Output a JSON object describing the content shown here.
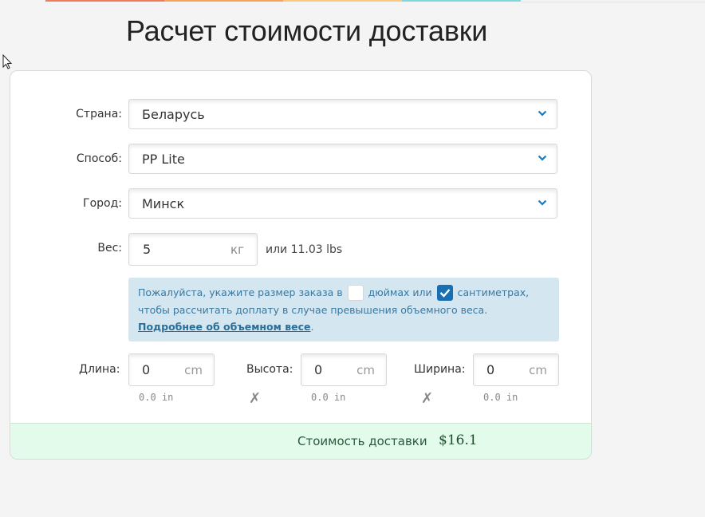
{
  "colors": {
    "top_segments": [
      "#f07a5a",
      "#f7a35c",
      "#fbc880",
      "#7dd8e0"
    ],
    "accent": "#1a6fb3",
    "chevron": "#1a7ac0"
  },
  "page": {
    "title": "Расчет стоимости доставки"
  },
  "form": {
    "country": {
      "label": "Страна:",
      "value": "Беларусь",
      "icon": "chevron-down-icon"
    },
    "method": {
      "label": "Способ:",
      "value": "PP Lite",
      "icon": "chevron-down-icon"
    },
    "city": {
      "label": "Город:",
      "value": "Минск",
      "icon": "chevron-down-icon"
    },
    "weight": {
      "label": "Вес:",
      "value": "5",
      "unit": "кг",
      "alt": "или 11.03 lbs"
    }
  },
  "info": {
    "text_before_inches": "Пожалуйста, укажите размер заказа в",
    "inches_label": "дюймах или",
    "inches_checked": false,
    "cm_label": "сантиметрах,",
    "cm_checked": true,
    "text_line2": "чтобы рассчитать доплату в случае превышения объемного веса.",
    "link": "Подробнее об объемном весе",
    "link_suffix": "."
  },
  "dimensions": {
    "length": {
      "label": "Длина:",
      "value": "0",
      "unit": "cm",
      "inches": "0.0 in"
    },
    "height": {
      "label": "Высота:",
      "value": "0",
      "unit": "cm",
      "inches": "0.0 in"
    },
    "width": {
      "label": "Ширина:",
      "value": "0",
      "unit": "cm",
      "inches": "0.0 in"
    },
    "separator": "✗"
  },
  "footer": {
    "label": "Стоимость доставки",
    "price": "$16.1"
  }
}
